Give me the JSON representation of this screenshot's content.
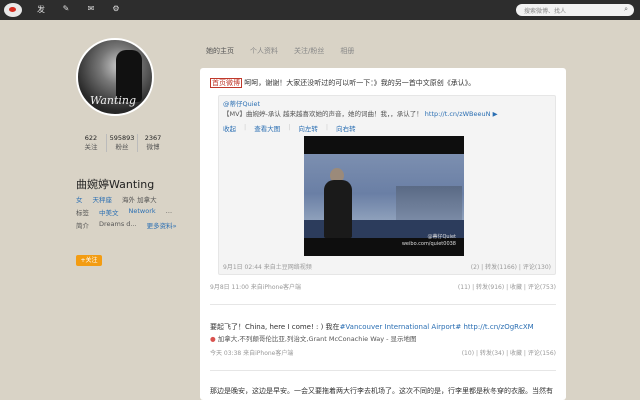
{
  "topbar": {
    "nav": [
      "logo-icon",
      "发",
      "✎",
      "✉",
      "⚙"
    ],
    "search_placeholder": "搜索微博、找人"
  },
  "profile": {
    "avatar_signature": "Wanting",
    "stats": [
      {
        "num": "622",
        "label": "关注"
      },
      {
        "num": "595893",
        "label": "粉丝"
      },
      {
        "num": "2367",
        "label": "微博"
      }
    ],
    "name": "曲婉婷Wanting",
    "row1": [
      "女",
      "天秤座",
      "海外 加拿大"
    ],
    "row2_label": "标签",
    "row2": [
      "中美文",
      "Network",
      "…"
    ],
    "row3_label": "简介",
    "row3_text": "Dreams d...",
    "row3_more": "更多资料»",
    "follow": "+关注"
  },
  "tabs": [
    "她的主页",
    "个人资料",
    "关注/粉丝",
    "相册"
  ],
  "post1": {
    "tag": "首页微博",
    "text": "呵呵，谢谢！大家还没听过的可以听一下：》我的另一首中文原创《承认》。",
    "repost_author": "@蒂仔Quiet",
    "repost_text": "【MV】曲婉婷-承认 越来越喜欢她的声音，她的词曲！我，，承认了！",
    "repost_link": "http://t.cn/zWBeeuN",
    "actions": [
      "收起",
      "查看大图",
      "向左转",
      "向右转"
    ],
    "video_watermark_1": "@蒂仔Quiet",
    "video_watermark_2": "weibo.com/quiet0038",
    "repost_time": "9月1日 02:44",
    "repost_source": "来自土豆网络视频",
    "repost_stats": "(2) | 转发(1166) | 评论(130)",
    "time": "9月8日 11:00",
    "source": "来自iPhone客户端",
    "stats": "(11) | 转发(916) | 收藏 | 评论(753)"
  },
  "post2": {
    "text_a": "要起飞了！China, here I come! : ) 我在",
    "text_tag": "#Vancouver International Airport#",
    "text_link": "http://t.cn/zOgRcXM",
    "location": "加拿大,不列颠哥伦比亚,列治文,Grant McConachie Way - 显示地图",
    "time": "今天 03:38",
    "source": "来自iPhone客户端",
    "stats": "(10) | 转发(34) | 收藏 | 评论(156)"
  },
  "post3": {
    "text": "那边是晚安，这边是早安。一会又要拖着两大行李去机场了。这次不同的是，行李里都是秋冬穿的衣服。当然有"
  }
}
